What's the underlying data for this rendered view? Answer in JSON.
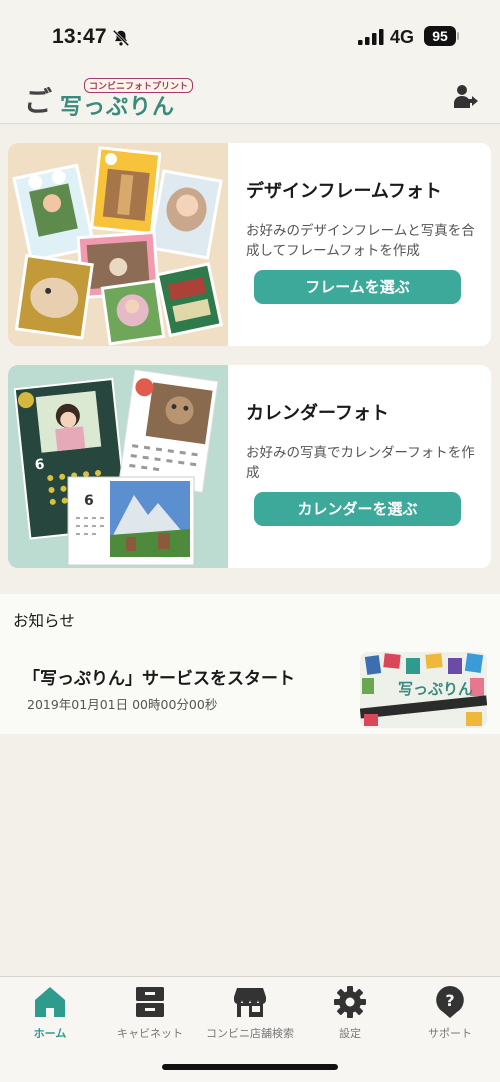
{
  "status_bar": {
    "time": "13:47",
    "network": "4G",
    "battery": "95",
    "icons": [
      "bell-slash-icon",
      "signal-icon",
      "battery-icon"
    ]
  },
  "header": {
    "logo_text": "写っぷりん",
    "logo_subtext": "コンビニフォトプリント",
    "logout_icon": "logout-icon"
  },
  "cards": [
    {
      "title": "デザインフレームフォト",
      "description": "お好みのデザインフレームと写真を合成してフレームフォトを作成",
      "button": "フレームを選ぶ"
    },
    {
      "title": "カレンダーフォト",
      "description": "お好みの写真でカレンダーフォトを作成",
      "button": "カレンダーを選ぶ"
    }
  ],
  "news": {
    "heading": "お知らせ",
    "items": [
      {
        "title": "「写っぷりん」サービスをスタート",
        "date": "2019年01月01日 00時00分00秒"
      }
    ]
  },
  "tabs": [
    {
      "label": "ホーム",
      "icon": "home-icon",
      "active": true
    },
    {
      "label": "キャビネット",
      "icon": "cabinet-icon",
      "active": false
    },
    {
      "label": "コンビニ店舗検索",
      "icon": "store-icon",
      "active": false
    },
    {
      "label": "設定",
      "icon": "gear-icon",
      "active": false
    },
    {
      "label": "サポート",
      "icon": "help-icon",
      "active": false
    }
  ],
  "colors": {
    "accent": "#3ca99a",
    "background": "#f3f0e9",
    "tab_active": "#2f9b8c"
  }
}
